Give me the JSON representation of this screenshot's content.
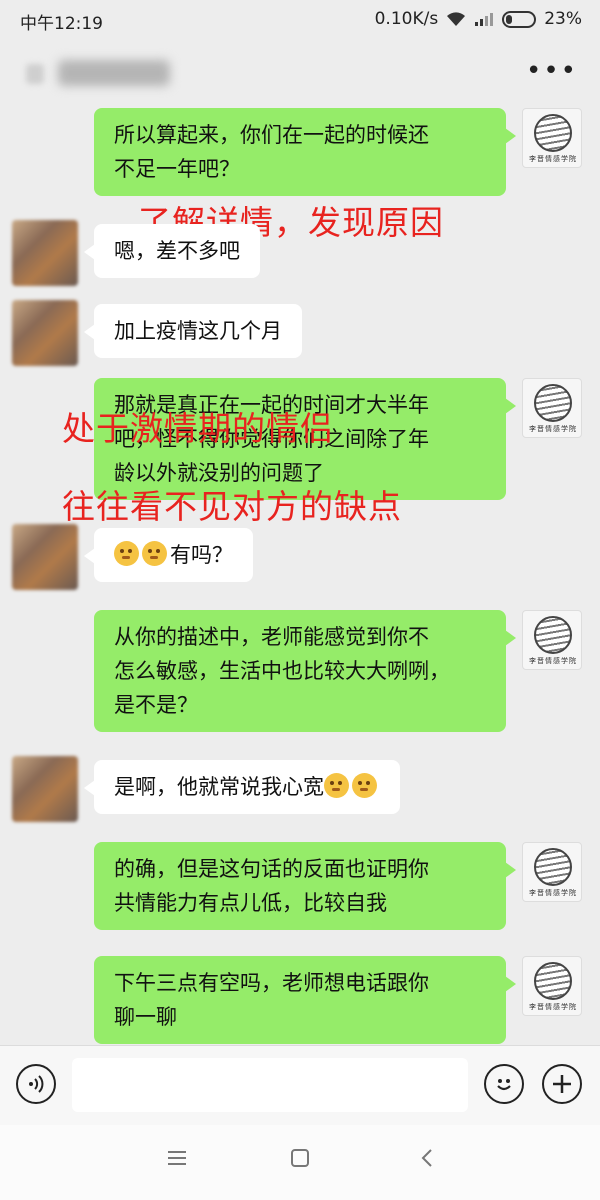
{
  "status": {
    "time": "中午12:19",
    "speed": "0.10K/s",
    "battery": "23%",
    "battery_level": 0.23
  },
  "header": {
    "contact_name": "",
    "more_label": "•••"
  },
  "logo": {
    "label": "李晋情感学院"
  },
  "messages": [
    {
      "side": "right",
      "lines": [
        "所以算起来，你们在一起的时候还",
        "不足一年吧？"
      ]
    },
    {
      "side": "left",
      "text": "嗯，差不多吧"
    },
    {
      "side": "left",
      "text": "加上疫情这几个月"
    },
    {
      "side": "right",
      "lines": [
        "那就是真正在一起的时间才大半年",
        "吧，怪不得你觉得你们之间除了年",
        "龄以外就没别的问题了"
      ]
    },
    {
      "side": "left",
      "emojis": [
        "pleading-face",
        "pleading-face"
      ],
      "text": "有吗？"
    },
    {
      "side": "right",
      "lines": [
        "从你的描述中，老师能感觉到你不",
        "怎么敏感，生活中也比较大大咧咧，",
        "是不是？"
      ]
    },
    {
      "side": "left",
      "text": "是啊，他就常说我心宽",
      "emojis": [
        "upside-down-smile",
        "upside-down-smile"
      ]
    },
    {
      "side": "right",
      "lines": [
        "的确，但是这句话的反面也证明你",
        "共情能力有点儿低，比较自我"
      ]
    },
    {
      "side": "right",
      "lines": [
        "下午三点有空吗，老师想电话跟你",
        "聊一聊"
      ]
    }
  ],
  "annotations": [
    {
      "text": "了解详情，发现原因"
    },
    {
      "text": "处于激情期的情侣"
    },
    {
      "text": "往往看不见对方的缺点"
    }
  ],
  "input": {
    "placeholder": ""
  },
  "colors": {
    "bubble_right": "#95ec69",
    "bubble_left": "#ffffff",
    "background": "#ededed",
    "annotation": "#e8231f"
  }
}
